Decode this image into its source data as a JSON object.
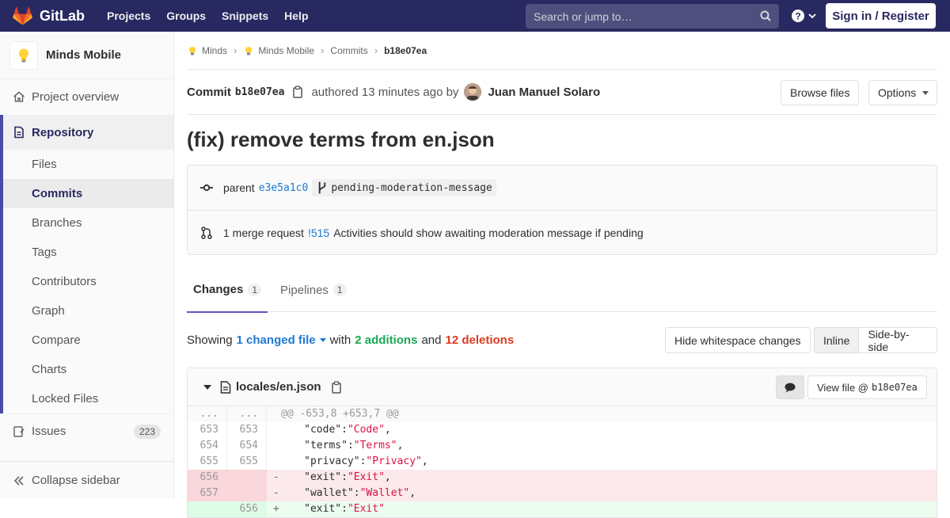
{
  "navbar": {
    "brand": "GitLab",
    "links": [
      "Projects",
      "Groups",
      "Snippets",
      "Help"
    ],
    "search_placeholder": "Search or jump to…",
    "signin": "Sign in / Register"
  },
  "sidebar": {
    "project_name": "Minds Mobile",
    "overview": "Project overview",
    "repository": "Repository",
    "repo_items": [
      "Files",
      "Commits",
      "Branches",
      "Tags",
      "Contributors",
      "Graph",
      "Compare",
      "Charts",
      "Locked Files"
    ],
    "issues": "Issues",
    "issues_count": "223",
    "collapse": "Collapse sidebar"
  },
  "breadcrumb": [
    "Minds",
    "Minds Mobile",
    "Commits",
    "b18e07ea"
  ],
  "commit": {
    "label": "Commit",
    "sha": "b18e07ea",
    "authored": "authored 13 minutes ago by",
    "author": "Juan Manuel Solaro",
    "browse": "Browse files",
    "options": "Options",
    "title": "(fix) remove terms from en.json",
    "parent_label": "parent",
    "parent_sha": "e3e5a1c0",
    "branch": "pending-moderation-message",
    "mr_text": "1 merge request",
    "mr_ref": "!515",
    "mr_title": "Activities should show awaiting moderation message if pending"
  },
  "tabs": [
    {
      "label": "Changes",
      "count": "1"
    },
    {
      "label": "Pipelines",
      "count": "1"
    }
  ],
  "summary": {
    "showing": "Showing",
    "changed": "1 changed file",
    "with": "with",
    "additions": "2 additions",
    "and": "and",
    "deletions": "12 deletions",
    "hide_ws": "Hide whitespace changes",
    "inline": "Inline",
    "side": "Side-by-side"
  },
  "file": {
    "name": "locales/en.json",
    "view_file": "View file @",
    "view_sha": "b18e07ea"
  },
  "diff": [
    {
      "type": "match",
      "old": "...",
      "new": "...",
      "sign": "",
      "key": "",
      "val": "",
      "text": "@@ -653,8 +653,7 @@"
    },
    {
      "type": "ctx",
      "old": "653",
      "new": "653",
      "sign": " ",
      "key": "\"code\"",
      "val": "\"Code\"",
      "text": ""
    },
    {
      "type": "ctx",
      "old": "654",
      "new": "654",
      "sign": " ",
      "key": "\"terms\"",
      "val": "\"Terms\"",
      "text": ""
    },
    {
      "type": "ctx",
      "old": "655",
      "new": "655",
      "sign": " ",
      "key": "\"privacy\"",
      "val": "\"Privacy\"",
      "text": ""
    },
    {
      "type": "del",
      "old": "656",
      "new": "",
      "sign": "-",
      "key": "\"exit\"",
      "val": "\"Exit\"",
      "text": ""
    },
    {
      "type": "del",
      "old": "657",
      "new": "",
      "sign": "-",
      "key": "\"wallet\"",
      "val": "\"Wallet\"",
      "text": ""
    },
    {
      "type": "add",
      "old": "",
      "new": "656",
      "sign": "+",
      "key": "\"exit\"",
      "val": "\"Exit\"",
      "text": ""
    }
  ]
}
